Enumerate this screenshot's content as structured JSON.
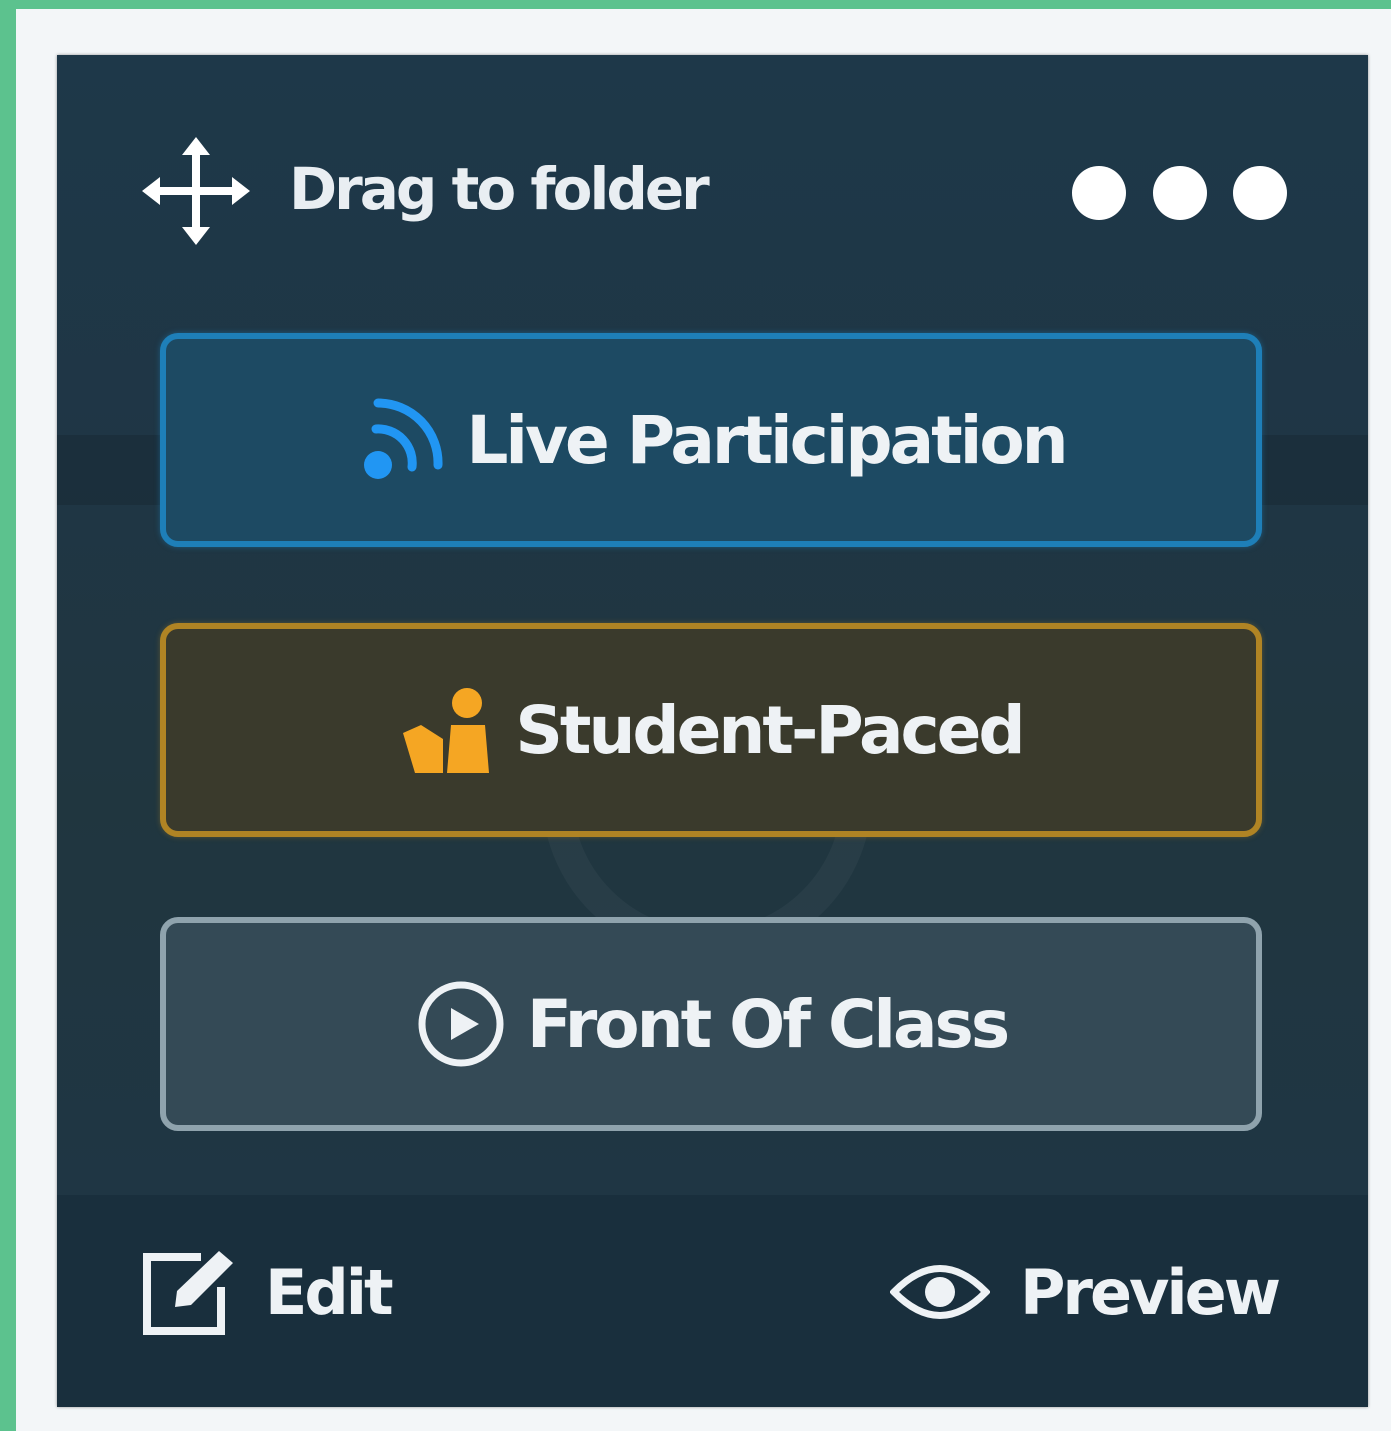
{
  "header": {
    "drag_label": "Drag to folder",
    "more_icon": "more-horizontal-icon",
    "move_icon": "move-arrows-icon"
  },
  "modes": [
    {
      "label": "Live Participation",
      "icon": "live-broadcast-icon",
      "accent": "#1e7fb8"
    },
    {
      "label": "Student-Paced",
      "icon": "student-reading-icon",
      "accent": "#b08424"
    },
    {
      "label": "Front Of Class",
      "icon": "play-circle-icon",
      "accent": "#8fa3ad"
    }
  ],
  "footer": {
    "edit_label": "Edit",
    "edit_icon": "edit-icon",
    "preview_label": "Preview",
    "preview_icon": "eye-icon"
  },
  "colors": {
    "frame": "#5cc28e",
    "card_bg": "#1f3645",
    "live_icon": "#2196f3",
    "student_icon": "#f5a623"
  }
}
